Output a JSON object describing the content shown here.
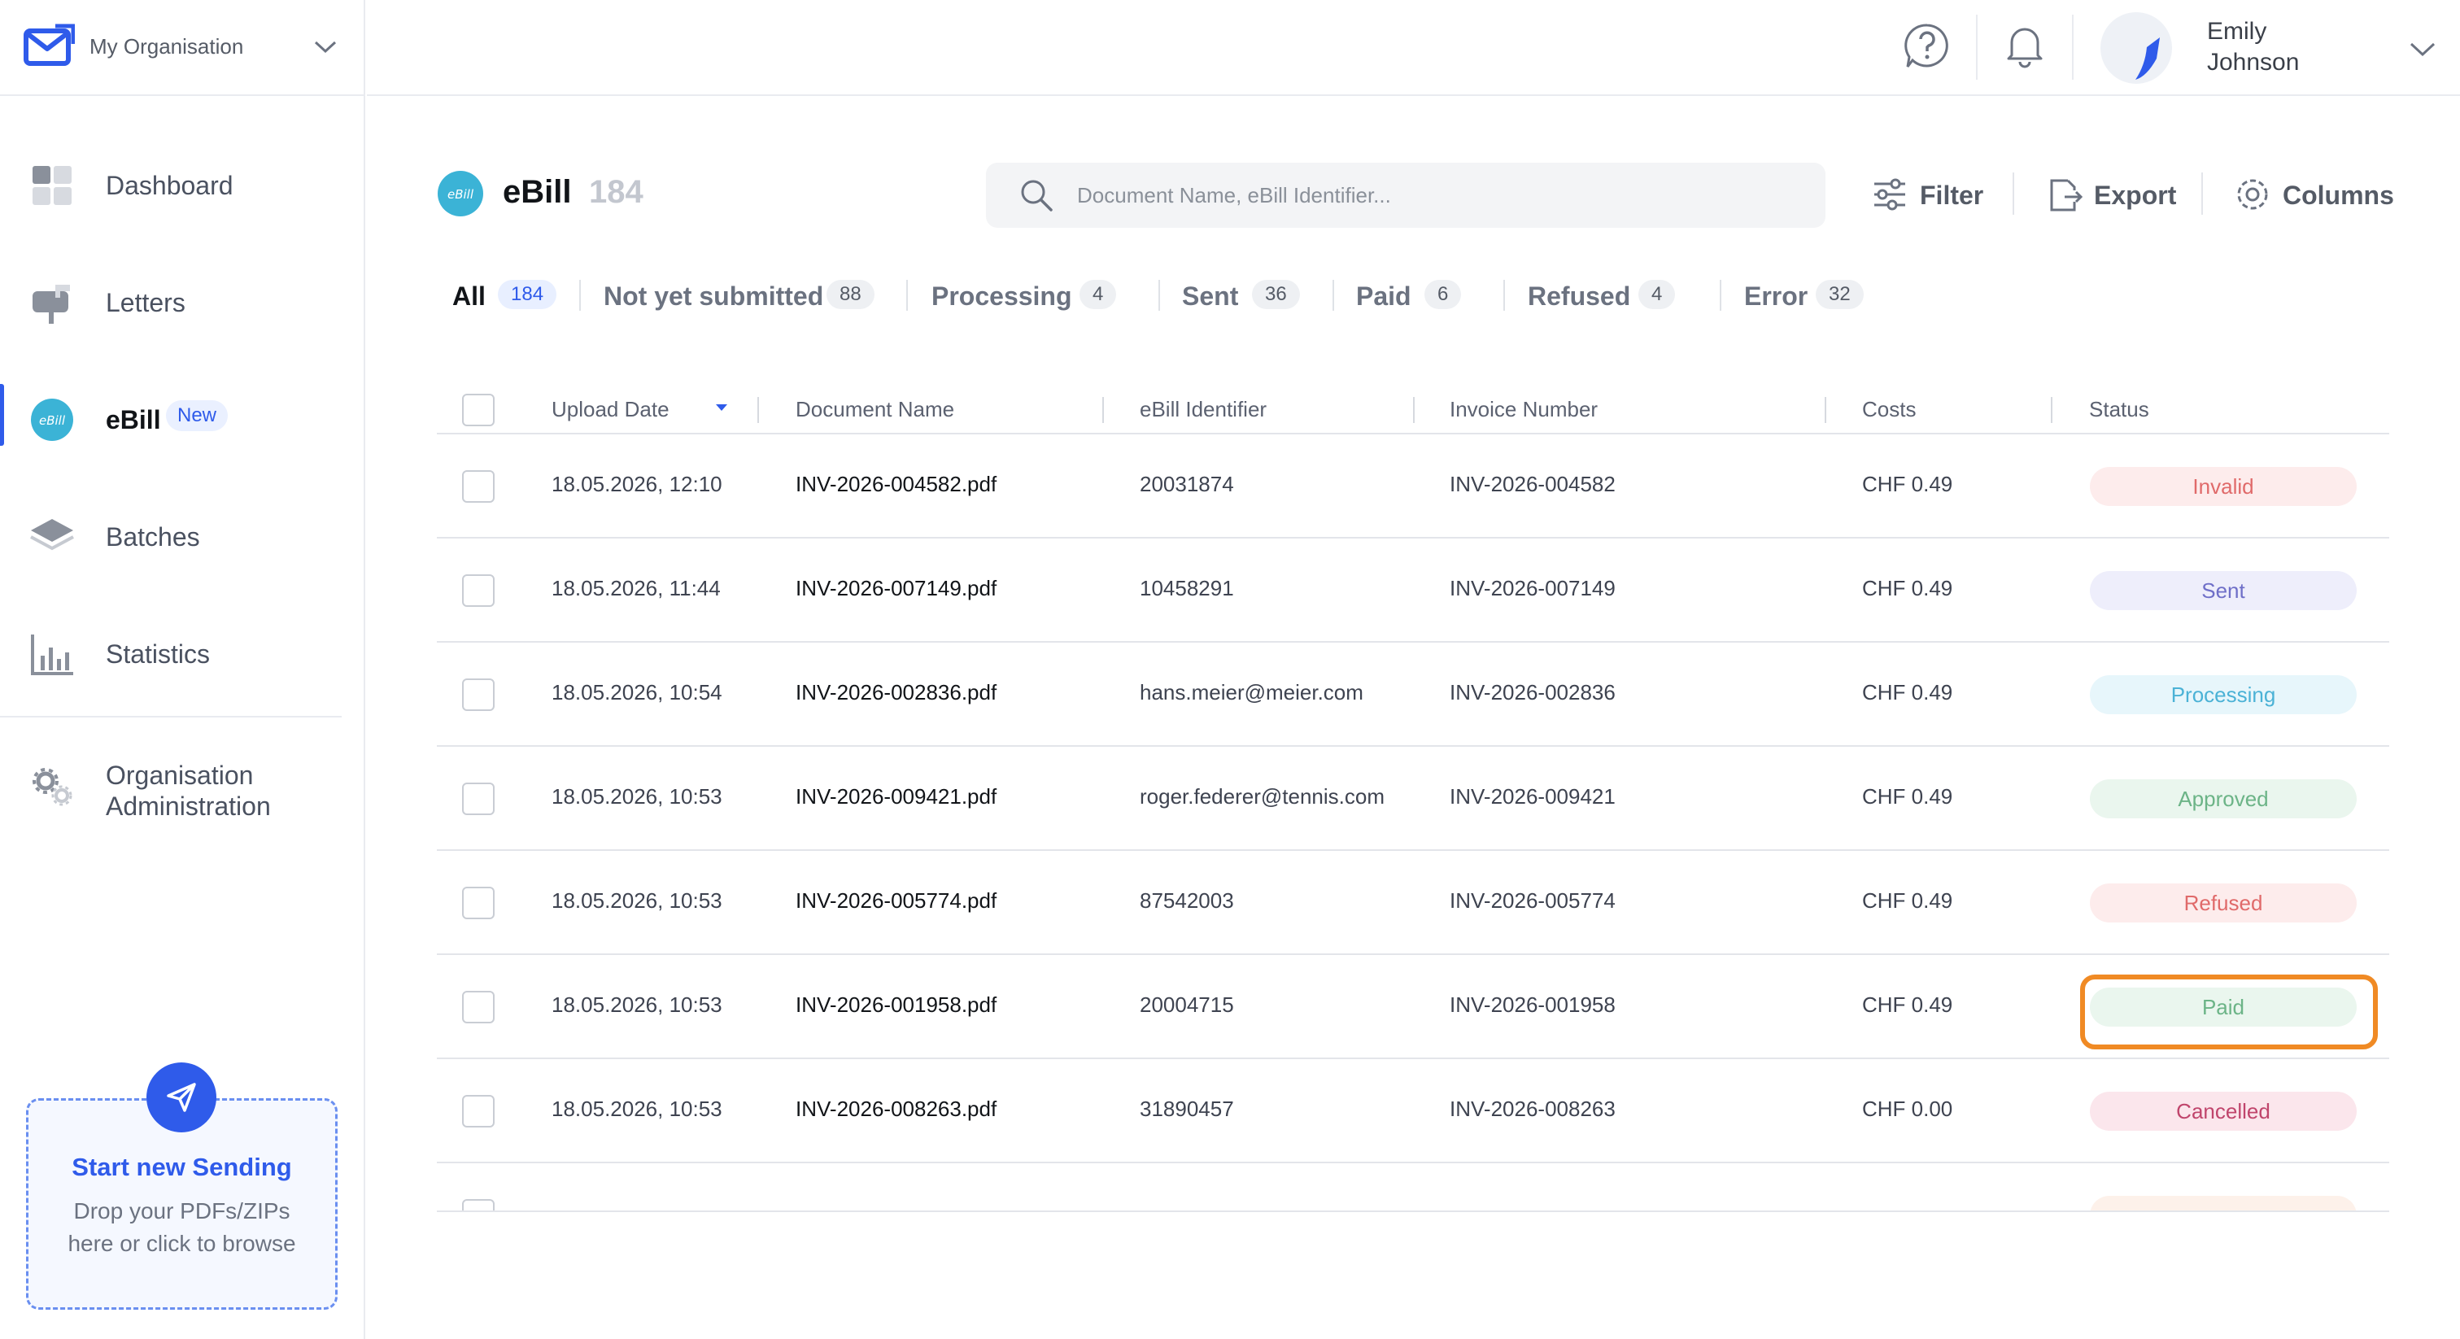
{
  "org": {
    "name": "My Organisation"
  },
  "user": {
    "first_name": "Emily",
    "last_name": "Johnson"
  },
  "sidebar": {
    "items": [
      {
        "label": "Dashboard"
      },
      {
        "label": "Letters"
      },
      {
        "label": "eBill",
        "badge": "New"
      },
      {
        "label": "Batches"
      },
      {
        "label": "Statistics"
      },
      {
        "label": "Organisation\nAdministration"
      }
    ],
    "drop": {
      "title": "Start new Sending",
      "subtitle": "Drop your PDFs/ZIPs\nhere or click to browse"
    }
  },
  "header": {
    "logo_text": "eBill",
    "title": "eBill",
    "count": "184",
    "search_placeholder": "Document Name, eBill Identifier...",
    "filter_label": "Filter",
    "export_label": "Export",
    "columns_label": "Columns"
  },
  "tabs": [
    {
      "label": "All",
      "count": "184"
    },
    {
      "label": "Not yet submitted",
      "count": "88"
    },
    {
      "label": "Processing",
      "count": "4"
    },
    {
      "label": "Sent",
      "count": "36"
    },
    {
      "label": "Paid",
      "count": "6"
    },
    {
      "label": "Refused",
      "count": "4"
    },
    {
      "label": "Error",
      "count": "32"
    }
  ],
  "table": {
    "columns": [
      "Upload Date",
      "Document Name",
      "eBill Identifier",
      "Invoice Number",
      "Costs",
      "Status"
    ],
    "rows": [
      {
        "date": "18.05.2026, 12:10",
        "doc": "INV-2026-004582.pdf",
        "ident": "20031874",
        "invoice": "INV-2026-004582",
        "cost": "CHF 0.49",
        "status": "Invalid"
      },
      {
        "date": "18.05.2026, 11:44",
        "doc": "INV-2026-007149.pdf",
        "ident": "10458291",
        "invoice": "INV-2026-007149",
        "cost": "CHF 0.49",
        "status": "Sent"
      },
      {
        "date": "18.05.2026, 10:54",
        "doc": "INV-2026-002836.pdf",
        "ident": "hans.meier@meier.com",
        "invoice": "INV-2026-002836",
        "cost": "CHF 0.49",
        "status": "Processing"
      },
      {
        "date": "18.05.2026, 10:53",
        "doc": "INV-2026-009421.pdf",
        "ident": "roger.federer@tennis.com",
        "invoice": "INV-2026-009421",
        "cost": "CHF 0.49",
        "status": "Approved"
      },
      {
        "date": "18.05.2026, 10:53",
        "doc": "INV-2026-005774.pdf",
        "ident": "87542003",
        "invoice": "INV-2026-005774",
        "cost": "CHF 0.49",
        "status": "Refused"
      },
      {
        "date": "18.05.2026, 10:53",
        "doc": "INV-2026-001958.pdf",
        "ident": "20004715",
        "invoice": "INV-2026-001958",
        "cost": "CHF 0.49",
        "status": "Paid"
      },
      {
        "date": "18.05.2026, 10:53",
        "doc": "INV-2026-008263.pdf",
        "ident": "31890457",
        "invoice": "INV-2026-008263",
        "cost": "CHF 0.00",
        "status": "Cancelled"
      }
    ]
  },
  "status_colors": {
    "Invalid": {
      "bg": "#fdecec",
      "fg": "#e06a6a"
    },
    "Sent": {
      "bg": "#eeeefb",
      "fg": "#6f6fc8"
    },
    "Processing": {
      "bg": "#e7f6fb",
      "fg": "#4bb2d6"
    },
    "Approved": {
      "bg": "#eaf6ee",
      "fg": "#6cb487"
    },
    "Refused": {
      "bg": "#fdecec",
      "fg": "#e06a6a"
    },
    "Paid": {
      "bg": "#eaf6ee",
      "fg": "#6cb487"
    },
    "Cancelled": {
      "bg": "#fbe6ec",
      "fg": "#c0456c"
    }
  },
  "colors": {
    "accent": "#2f5bea",
    "highlight": "#f08a24",
    "ebill_logo": "#3bb3d6"
  },
  "icons": {
    "org_logo": "mail-logo-icon",
    "dashboard": "dashboard-icon",
    "letters": "mailbox-icon",
    "ebill": "ebill-icon",
    "batches": "layers-icon",
    "statistics": "bar-chart-icon",
    "org_admin": "gears-icon",
    "help": "help-icon",
    "bell": "bell-icon",
    "search": "search-icon",
    "filter": "sliders-icon",
    "export": "export-icon",
    "columns": "gear-icon",
    "send": "paper-plane-icon"
  },
  "highlighted_row": "Paid"
}
